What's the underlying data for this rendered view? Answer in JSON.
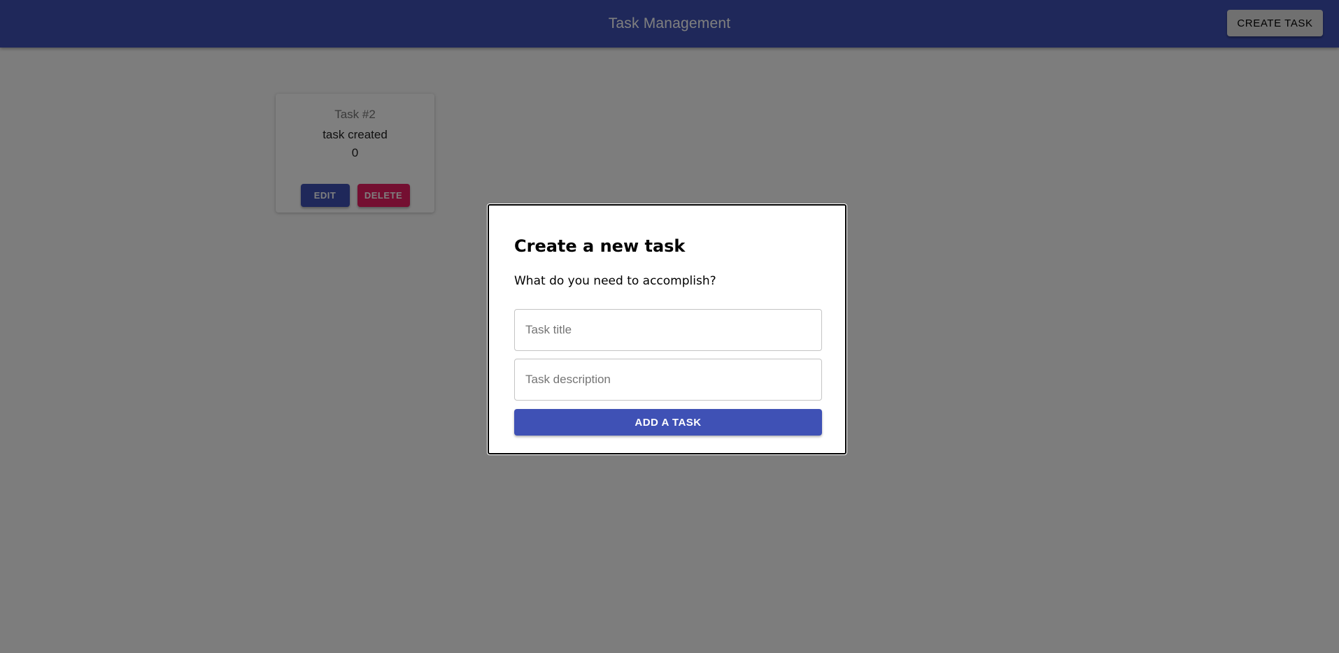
{
  "app": {
    "title": "Task Management",
    "create_button_label": "CREATE TASK"
  },
  "tasks": [
    {
      "title": "Task #2",
      "description": "task created",
      "value": "0",
      "edit_label": "EDIT",
      "delete_label": "DELETE"
    }
  ],
  "dialog": {
    "title": "Create a new task",
    "text": "What do you need to accomplish?",
    "title_field": {
      "value": "",
      "placeholder": "Task title"
    },
    "description_field": {
      "value": "",
      "placeholder": "Task description"
    },
    "submit_label": "ADD A TASK"
  },
  "colors": {
    "primary": "#3f51b5",
    "secondary": "#e91e63",
    "overlay": "rgba(0,0,0,0.5)"
  }
}
